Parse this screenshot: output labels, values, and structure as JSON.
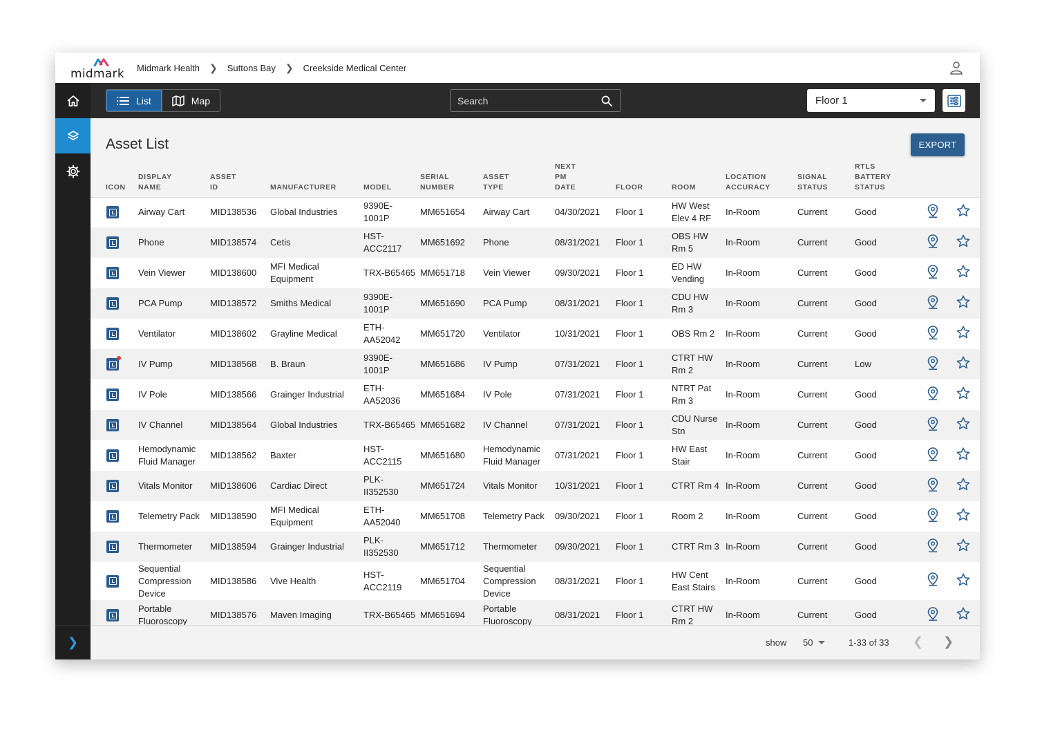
{
  "brand": {
    "logo_text": "midmark",
    "colors": {
      "accent_blue": "#1f8bd0",
      "dark_navy": "#2b5d8e",
      "toolbar": "#2a2a2a",
      "sidebar": "#1f1f1f",
      "alert_red": "#e53935"
    }
  },
  "breadcrumbs": [
    "Midmark Health",
    "Suttons Bay",
    "Creekside Medical Center"
  ],
  "toolbar": {
    "list_label": "List",
    "map_label": "Map",
    "search_placeholder": "Search",
    "floor_value": "Floor 1"
  },
  "page": {
    "title": "Asset List",
    "export_label": "EXPORT"
  },
  "table": {
    "headers": [
      [
        "ICON"
      ],
      [
        "DISPLAY",
        "NAME"
      ],
      [
        "ASSET",
        "ID"
      ],
      [
        "MANUFACTURER"
      ],
      [
        "MODEL"
      ],
      [
        "SERIAL",
        "NUMBER"
      ],
      [
        "ASSET",
        "TYPE"
      ],
      [
        "NEXT",
        "PM",
        "DATE"
      ],
      [
        "FLOOR"
      ],
      [
        "ROOM"
      ],
      [
        "LOCATION",
        "ACCURACY"
      ],
      [
        "SIGNAL",
        "STATUS"
      ],
      [
        "RTLS",
        "BATTERY",
        "STATUS"
      ]
    ],
    "rows": [
      {
        "name": "Airway Cart",
        "id": "MID138536",
        "manufacturer": "Global Industries",
        "model": "9390E-1001P",
        "serial": "MM651654",
        "type": "Airway Cart",
        "pm": "04/30/2021",
        "floor": "Floor 1",
        "room": "HW West Elev 4 RF",
        "accuracy": "In-Room",
        "signal": "Current",
        "battery": "Good",
        "alert": false
      },
      {
        "name": "Phone",
        "id": "MID138574",
        "manufacturer": "Cetis",
        "model": "HST-ACC2117",
        "serial": "MM651692",
        "type": "Phone",
        "pm": "08/31/2021",
        "floor": "Floor 1",
        "room": "OBS HW Rm 5",
        "accuracy": "In-Room",
        "signal": "Current",
        "battery": "Good",
        "alert": false
      },
      {
        "name": "Vein Viewer",
        "id": "MID138600",
        "manufacturer": "MFI Medical Equipment",
        "model": "TRX-B65465",
        "serial": "MM651718",
        "type": "Vein Viewer",
        "pm": "09/30/2021",
        "floor": "Floor 1",
        "room": "ED HW Vending",
        "accuracy": "In-Room",
        "signal": "Current",
        "battery": "Good",
        "alert": false
      },
      {
        "name": "PCA Pump",
        "id": "MID138572",
        "manufacturer": "Smiths Medical",
        "model": "9390E-1001P",
        "serial": "MM651690",
        "type": "PCA Pump",
        "pm": "08/31/2021",
        "floor": "Floor 1",
        "room": "CDU HW Rm 3",
        "accuracy": "In-Room",
        "signal": "Current",
        "battery": "Good",
        "alert": false
      },
      {
        "name": "Ventilator",
        "id": "MID138602",
        "manufacturer": "Grayline Medical",
        "model": "ETH-AA52042",
        "serial": "MM651720",
        "type": "Ventilator",
        "pm": "10/31/2021",
        "floor": "Floor 1",
        "room": "OBS Rm 2",
        "accuracy": "In-Room",
        "signal": "Current",
        "battery": "Good",
        "alert": false
      },
      {
        "name": "IV Pump",
        "id": "MID138568",
        "manufacturer": "B. Braun",
        "model": "9390E-1001P",
        "serial": "MM651686",
        "type": "IV Pump",
        "pm": "07/31/2021",
        "floor": "Floor 1",
        "room": "CTRT HW Rm 2",
        "accuracy": "In-Room",
        "signal": "Current",
        "battery": "Low",
        "alert": true
      },
      {
        "name": "IV Pole",
        "id": "MID138566",
        "manufacturer": "Grainger Industrial",
        "model": "ETH-AA52036",
        "serial": "MM651684",
        "type": "IV Pole",
        "pm": "07/31/2021",
        "floor": "Floor 1",
        "room": "NTRT Pat Rm 3",
        "accuracy": "In-Room",
        "signal": "Current",
        "battery": "Good",
        "alert": false
      },
      {
        "name": "IV Channel",
        "id": "MID138564",
        "manufacturer": "Global Industries",
        "model": "TRX-B65465",
        "serial": "MM651682",
        "type": "IV Channel",
        "pm": "07/31/2021",
        "floor": "Floor 1",
        "room": "CDU Nurse Stn",
        "accuracy": "In-Room",
        "signal": "Current",
        "battery": "Good",
        "alert": false
      },
      {
        "name": "Hemodynamic Fluid Manager",
        "id": "MID138562",
        "manufacturer": "Baxter",
        "model": "HST-ACC2115",
        "serial": "MM651680",
        "type": "Hemodynamic Fluid Manager",
        "pm": "07/31/2021",
        "floor": "Floor 1",
        "room": "HW East Stair",
        "accuracy": "In-Room",
        "signal": "Current",
        "battery": "Good",
        "alert": false
      },
      {
        "name": "Vitals Monitor",
        "id": "MID138606",
        "manufacturer": "Cardiac Direct",
        "model": "PLK-II352530",
        "serial": "MM651724",
        "type": "Vitals Monitor",
        "pm": "10/31/2021",
        "floor": "Floor 1",
        "room": "CTRT Rm 4",
        "accuracy": "In-Room",
        "signal": "Current",
        "battery": "Good",
        "alert": false
      },
      {
        "name": "Telemetry Pack",
        "id": "MID138590",
        "manufacturer": "MFI Medical Equipment",
        "model": "ETH-AA52040",
        "serial": "MM651708",
        "type": "Telemetry Pack",
        "pm": "09/30/2021",
        "floor": "Floor 1",
        "room": "Room 2",
        "accuracy": "In-Room",
        "signal": "Current",
        "battery": "Good",
        "alert": false
      },
      {
        "name": "Thermometer",
        "id": "MID138594",
        "manufacturer": "Grainger Industrial",
        "model": "PLK-II352530",
        "serial": "MM651712",
        "type": "Thermometer",
        "pm": "09/30/2021",
        "floor": "Floor 1",
        "room": "CTRT Rm 3",
        "accuracy": "In-Room",
        "signal": "Current",
        "battery": "Good",
        "alert": false
      },
      {
        "name": "Sequential Compression Device",
        "id": "MID138586",
        "manufacturer": "Vive Health",
        "model": "HST-ACC2119",
        "serial": "MM651704",
        "type": "Sequential Compression Device",
        "pm": "08/31/2021",
        "floor": "Floor 1",
        "room": "HW Cent East Stairs",
        "accuracy": "In-Room",
        "signal": "Current",
        "battery": "Good",
        "alert": false,
        "tall": true
      },
      {
        "name": "Portable Fluoroscopy",
        "id": "MID138576",
        "manufacturer": "Maven Imaging",
        "model": "TRX-B65465",
        "serial": "MM651694",
        "type": "Portable Fluoroscopy",
        "pm": "08/31/2021",
        "floor": "Floor 1",
        "room": "CTRT HW Rm 2",
        "accuracy": "In-Room",
        "signal": "Current",
        "battery": "Good",
        "alert": false
      }
    ]
  },
  "footer": {
    "show_label": "show",
    "per_page": "50",
    "range": "1-33 of 33"
  }
}
